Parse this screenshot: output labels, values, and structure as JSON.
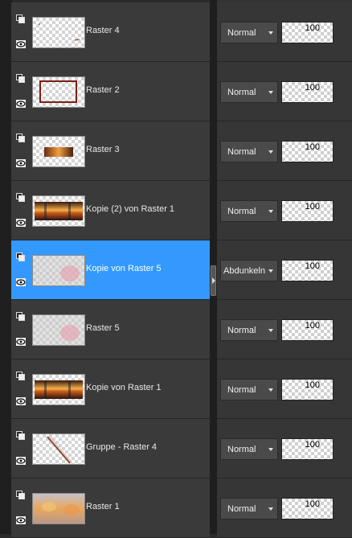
{
  "layers": [
    {
      "name": "Raster 4",
      "blend": "Normal",
      "opacity": "100",
      "selected": false,
      "thumb": "sparse"
    },
    {
      "name": "Raster 2",
      "blend": "Normal",
      "opacity": "100",
      "selected": false,
      "thumb": "frame"
    },
    {
      "name": "Raster 3",
      "blend": "Normal",
      "opacity": "100",
      "selected": false,
      "thumb": "small-fire"
    },
    {
      "name": "Kopie (2) von Raster 1",
      "blend": "Normal",
      "opacity": "100",
      "selected": false,
      "thumb": "fire-band"
    },
    {
      "name": "Kopie von Raster 5",
      "blend": "Abdunkeln",
      "opacity": "100",
      "selected": true,
      "thumb": "pink-blur"
    },
    {
      "name": "Raster 5",
      "blend": "Normal",
      "opacity": "100",
      "selected": false,
      "thumb": "pink-blur"
    },
    {
      "name": "Kopie von Raster 1",
      "blend": "Normal",
      "opacity": "100",
      "selected": false,
      "thumb": "fire-band"
    },
    {
      "name": "Gruppe - Raster 4",
      "blend": "Normal",
      "opacity": "100",
      "selected": false,
      "thumb": "diagonal"
    },
    {
      "name": "Raster 1",
      "blend": "Normal",
      "opacity": "100",
      "selected": false,
      "thumb": "full"
    }
  ],
  "colors": {
    "selected": "#3399ff",
    "row": "#3a3a3a",
    "panel": "#2b2b2b"
  }
}
